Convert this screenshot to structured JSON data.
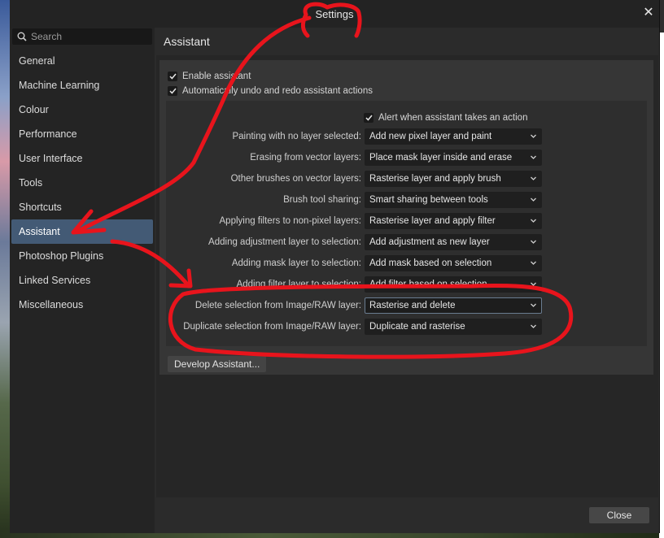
{
  "window": {
    "title": "Settings"
  },
  "sidebar": {
    "search_placeholder": "Search",
    "items": [
      {
        "label": "General"
      },
      {
        "label": "Machine Learning"
      },
      {
        "label": "Colour"
      },
      {
        "label": "Performance"
      },
      {
        "label": "User Interface"
      },
      {
        "label": "Tools"
      },
      {
        "label": "Shortcuts"
      },
      {
        "label": "Assistant",
        "active": true
      },
      {
        "label": "Photoshop Plugins"
      },
      {
        "label": "Linked Services"
      },
      {
        "label": "Miscellaneous"
      }
    ]
  },
  "main": {
    "title": "Assistant",
    "enable_assistant": {
      "label": "Enable assistant",
      "checked": true
    },
    "auto_undo": {
      "label": "Automatically undo and redo assistant actions",
      "checked": true
    },
    "alert": {
      "label": "Alert when assistant takes an action",
      "checked": true
    },
    "options": [
      {
        "label": "Painting with no layer selected:",
        "value": "Add new pixel layer and paint"
      },
      {
        "label": "Erasing from vector layers:",
        "value": "Place mask layer inside and erase"
      },
      {
        "label": "Other brushes on vector layers:",
        "value": "Rasterise layer and apply brush"
      },
      {
        "label": "Brush tool sharing:",
        "value": "Smart sharing between tools"
      },
      {
        "label": "Applying filters to non-pixel layers:",
        "value": "Rasterise layer and apply filter"
      },
      {
        "label": "Adding adjustment layer to selection:",
        "value": "Add adjustment as new layer"
      },
      {
        "label": "Adding mask layer to selection:",
        "value": "Add mask based on selection"
      },
      {
        "label": "Adding filter layer to selection:",
        "value": "Add filter based on selection"
      },
      {
        "label": "Delete selection from Image/RAW layer:",
        "value": "Rasterise and delete",
        "focused": true
      },
      {
        "label": "Duplicate selection from Image/RAW layer:",
        "value": "Duplicate and rasterise"
      }
    ],
    "develop_button": "Develop Assistant..."
  },
  "footer": {
    "close_label": "Close"
  },
  "colors": {
    "accent": "#435a75",
    "annotation": "#e8141c"
  }
}
